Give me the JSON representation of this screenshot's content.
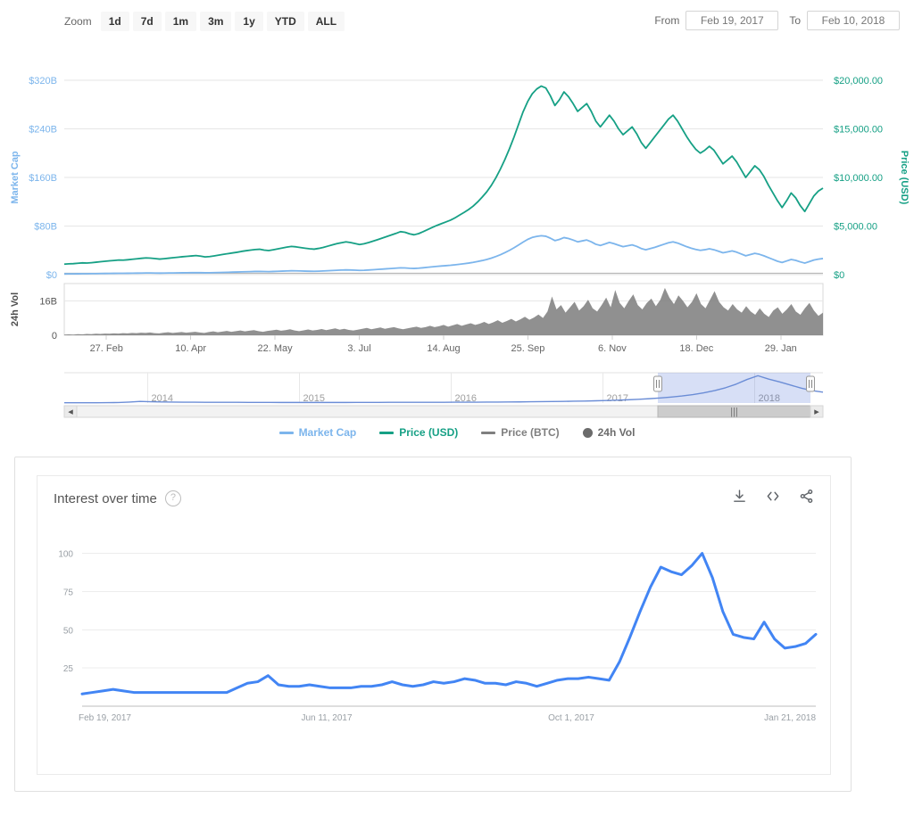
{
  "toolbar": {
    "zoom_label": "Zoom",
    "zoom_buttons": [
      "1d",
      "7d",
      "1m",
      "3m",
      "1y",
      "YTD",
      "ALL"
    ],
    "from_label": "From",
    "from_value": "Feb 19, 2017",
    "to_label": "To",
    "to_value": "Feb 10, 2018"
  },
  "legend": [
    {
      "label": "Market Cap",
      "color": "#7cb5ec",
      "marker": "line"
    },
    {
      "label": "Price (USD)",
      "color": "#16a085",
      "marker": "line"
    },
    {
      "label": "Price (BTC)",
      "color": "#7f7f7f",
      "marker": "line"
    },
    {
      "label": "24h Vol",
      "color": "#6b6b6b",
      "marker": "dot"
    }
  ],
  "navigator": {
    "year_labels": [
      "2014",
      "2015",
      "2016",
      "2017",
      "2018"
    ],
    "selected_from": "2017",
    "selected_to": "2018",
    "handle_left_name": "navigator-handle-left",
    "handle_right_name": "navigator-handle-right",
    "scroll_left_icon": "◂",
    "scroll_right_icon": "▸",
    "grip_icon": "|||"
  },
  "trends_card": {
    "title": "Interest over time",
    "help_icon": "?",
    "actions": [
      {
        "name": "download-icon",
        "title": "download"
      },
      {
        "name": "embed-icon",
        "title": "embed"
      },
      {
        "name": "share-icon",
        "title": "share"
      }
    ]
  },
  "chart_data": [
    {
      "type": "line",
      "title": "",
      "id": "market-cap-price",
      "xlabel": "",
      "x_ticks": [
        "27. Feb",
        "10. Apr",
        "22. May",
        "3. Jul",
        "14. Aug",
        "25. Sep",
        "6. Nov",
        "18. Dec",
        "29. Jan"
      ],
      "left_axis": {
        "label": "Market Cap",
        "color": "#7cb5ec",
        "ticks": [
          "$0",
          "$80B",
          "$160B",
          "$240B",
          "$320B"
        ],
        "ylim": [
          0,
          320
        ]
      },
      "right_axis": {
        "label": "Price (USD)",
        "color": "#16a085",
        "ticks": [
          "$0",
          "$5,000.00",
          "$10,000.00",
          "$15,000.00",
          "$20,000.00"
        ],
        "ylim": [
          0,
          20000
        ]
      },
      "grid": true,
      "legend_position": "bottom",
      "series": [
        {
          "name": "Market Cap",
          "color": "#7cb5ec",
          "values": [
            1.2,
            1.3,
            1.3,
            1.4,
            1.5,
            1.5,
            1.6,
            1.7,
            1.8,
            1.9,
            2.0,
            2.1,
            2.2,
            2.2,
            2.3,
            2.4,
            2.5,
            2.6,
            2.7,
            2.7,
            2.6,
            2.5,
            2.6,
            2.7,
            2.8,
            2.9,
            3.0,
            3.1,
            3.2,
            3.3,
            3.2,
            3.0,
            3.1,
            3.3,
            3.5,
            3.7,
            3.9,
            4.1,
            4.3,
            4.6,
            4.8,
            5.0,
            5.2,
            5.3,
            5.1,
            5.0,
            5.2,
            5.5,
            5.8,
            6.1,
            6.3,
            6.2,
            6.0,
            5.8,
            5.6,
            5.5,
            5.7,
            6.0,
            6.4,
            6.8,
            7.2,
            7.5,
            7.8,
            7.6,
            7.3,
            7.0,
            7.2,
            7.6,
            8.1,
            8.6,
            9.1,
            9.6,
            10.1,
            10.6,
            11.2,
            11.0,
            10.5,
            10.2,
            10.6,
            11.3,
            12.1,
            12.9,
            13.6,
            14.2,
            14.8,
            15.4,
            16.2,
            17.1,
            18.0,
            19.0,
            20.2,
            21.6,
            23.2,
            25.0,
            27.2,
            29.8,
            32.8,
            36.2,
            40.0,
            44.2,
            48.8,
            53.6,
            58.0,
            61.2,
            63.0,
            64.0,
            63.2,
            60.0,
            56.0,
            58.0,
            61.0,
            59.5,
            57.0,
            54.0,
            55.5,
            57.0,
            54.0,
            50.0,
            48.0,
            50.5,
            53.0,
            51.0,
            48.5,
            46.0,
            47.5,
            49.0,
            46.5,
            43.0,
            41.0,
            43.0,
            45.0,
            47.5,
            50.0,
            52.5,
            54.0,
            52.0,
            49.0,
            46.0,
            43.5,
            41.5,
            40.0,
            41.0,
            42.5,
            41.0,
            38.5,
            36.0,
            37.5,
            39.0,
            37.0,
            34.0,
            31.0,
            33.0,
            35.0,
            33.5,
            31.0,
            28.0,
            25.0,
            22.0,
            20.0,
            22.5,
            25.0,
            23.5,
            21.0,
            19.0,
            21.5,
            24.0,
            25.5,
            26.5
          ]
        },
        {
          "name": "Price (USD)",
          "color": "#16a085",
          "values": [
            1080,
            1110,
            1130,
            1170,
            1210,
            1190,
            1230,
            1280,
            1330,
            1380,
            1420,
            1460,
            1500,
            1490,
            1530,
            1580,
            1630,
            1680,
            1720,
            1700,
            1650,
            1600,
            1640,
            1690,
            1740,
            1790,
            1840,
            1880,
            1920,
            1960,
            1900,
            1820,
            1860,
            1930,
            2010,
            2090,
            2160,
            2230,
            2300,
            2390,
            2460,
            2520,
            2580,
            2610,
            2520,
            2480,
            2560,
            2650,
            2740,
            2830,
            2900,
            2860,
            2790,
            2720,
            2660,
            2620,
            2700,
            2800,
            2930,
            3060,
            3190,
            3280,
            3370,
            3300,
            3200,
            3100,
            3180,
            3300,
            3450,
            3600,
            3760,
            3920,
            4080,
            4240,
            4420,
            4360,
            4200,
            4100,
            4220,
            4420,
            4640,
            4860,
            5060,
            5240,
            5420,
            5600,
            5840,
            6120,
            6400,
            6700,
            7050,
            7480,
            7980,
            8520,
            9180,
            9960,
            10860,
            11860,
            12960,
            14160,
            15460,
            16760,
            17800,
            18600,
            19100,
            19400,
            19200,
            18400,
            17400,
            18000,
            18800,
            18300,
            17600,
            16800,
            17200,
            17600,
            16800,
            15800,
            15200,
            15800,
            16400,
            15800,
            15000,
            14400,
            14800,
            15200,
            14500,
            13600,
            13000,
            13600,
            14200,
            14800,
            15400,
            16000,
            16400,
            15800,
            15000,
            14200,
            13500,
            12900,
            12500,
            12800,
            13200,
            12800,
            12100,
            11400,
            11800,
            12200,
            11600,
            10800,
            10000,
            10600,
            11200,
            10800,
            10100,
            9200,
            8400,
            7600,
            6900,
            7600,
            8400,
            7900,
            7100,
            6500,
            7300,
            8100,
            8600,
            8900
          ]
        },
        {
          "name": "Price (BTC)",
          "color": "#7f7f7f",
          "values": [
            1,
            1,
            1,
            1,
            1,
            1,
            1,
            1,
            1,
            1,
            1,
            1,
            1,
            1,
            1,
            1,
            1,
            1,
            1,
            1,
            1,
            1,
            1,
            1,
            1,
            1,
            1,
            1,
            1,
            1,
            1,
            1,
            1,
            1,
            1,
            1,
            1,
            1,
            1,
            1,
            1,
            1,
            1,
            1,
            1,
            1,
            1,
            1,
            1,
            1,
            1,
            1,
            1,
            1,
            1,
            1,
            1,
            1,
            1,
            1,
            1,
            1,
            1,
            1,
            1,
            1,
            1,
            1,
            1,
            1,
            1,
            1,
            1,
            1,
            1,
            1,
            1,
            1,
            1,
            1,
            1,
            1,
            1,
            1,
            1,
            1,
            1,
            1,
            1,
            1,
            1,
            1,
            1,
            1,
            1,
            1,
            1,
            1,
            1,
            1,
            1,
            1,
            1,
            1,
            1,
            1,
            1,
            1,
            1,
            1,
            1,
            1,
            1,
            1,
            1,
            1,
            1,
            1,
            1,
            1,
            1,
            1,
            1,
            1,
            1,
            1,
            1,
            1,
            1,
            1,
            1,
            1,
            1,
            1,
            1,
            1,
            1,
            1,
            1,
            1,
            1,
            1,
            1,
            1,
            1,
            1,
            1,
            1,
            1,
            1,
            1,
            1,
            1,
            1,
            1,
            1,
            1,
            1,
            1,
            1,
            1,
            1,
            1,
            1,
            1,
            1,
            1,
            1,
            1,
            1
          ]
        }
      ]
    },
    {
      "type": "area",
      "id": "volume",
      "title": "",
      "left_axis": {
        "label": "24h Vol",
        "color": "#4d4d4d",
        "ticks": [
          "0",
          "16B"
        ],
        "ylim": [
          0,
          24
        ]
      },
      "grid": true,
      "series": [
        {
          "name": "24h Vol",
          "color": "#7c7c7c",
          "values": [
            0.3,
            0.4,
            0.3,
            0.5,
            0.4,
            0.6,
            0.5,
            0.7,
            0.6,
            0.8,
            0.7,
            0.9,
            0.8,
            1.0,
            0.9,
            1.1,
            1.0,
            1.2,
            1.1,
            1.3,
            1.0,
            0.9,
            1.2,
            1.4,
            1.1,
            1.3,
            1.5,
            1.2,
            1.4,
            1.6,
            1.3,
            1.1,
            1.5,
            1.8,
            1.4,
            1.7,
            2.0,
            1.6,
            1.9,
            2.2,
            1.8,
            2.1,
            2.4,
            1.9,
            1.6,
            2.0,
            2.3,
            2.6,
            2.1,
            2.4,
            2.8,
            2.2,
            1.9,
            2.3,
            2.7,
            2.2,
            2.5,
            2.9,
            2.4,
            2.8,
            3.2,
            2.6,
            3.0,
            2.5,
            2.2,
            2.6,
            3.0,
            3.4,
            2.8,
            3.2,
            3.6,
            3.0,
            3.4,
            3.8,
            3.2,
            2.8,
            3.2,
            3.6,
            4.0,
            3.4,
            3.8,
            4.4,
            3.8,
            4.2,
            4.8,
            4.0,
            4.6,
            5.2,
            4.4,
            5.0,
            5.6,
            4.8,
            5.4,
            6.2,
            5.2,
            6.0,
            7.0,
            5.8,
            6.6,
            7.6,
            6.4,
            7.4,
            8.6,
            7.2,
            8.2,
            9.6,
            8.0,
            11.0,
            18.0,
            12.0,
            14.0,
            10.5,
            13.0,
            15.5,
            11.5,
            13.5,
            16.5,
            12.5,
            11.0,
            14.0,
            17.5,
            13.0,
            21.0,
            15.0,
            12.5,
            16.0,
            19.0,
            14.0,
            12.0,
            15.0,
            17.0,
            13.5,
            16.5,
            22.0,
            17.5,
            14.5,
            18.5,
            16.0,
            13.0,
            15.5,
            19.5,
            14.5,
            12.5,
            16.5,
            20.5,
            15.5,
            13.0,
            11.5,
            14.5,
            12.0,
            10.5,
            13.5,
            11.0,
            9.5,
            12.5,
            10.0,
            8.5,
            11.5,
            13.0,
            10.0,
            12.0,
            14.5,
            11.0,
            9.5,
            12.5,
            15.0,
            11.5,
            9.0,
            10.5
          ]
        }
      ]
    },
    {
      "type": "line",
      "id": "navigator",
      "title": "",
      "x_ticks": [
        "2014",
        "2015",
        "2016",
        "2017",
        "2018"
      ],
      "series": [
        {
          "name": "Market Cap",
          "color": "#6b8dd6",
          "values": [
            0.4,
            0.4,
            0.5,
            0.5,
            0.6,
            0.8,
            1.6,
            2.6,
            2.0,
            1.7,
            1.5,
            1.4,
            1.3,
            1.2,
            1.2,
            1.1,
            1.1,
            1.0,
            1.0,
            1.0,
            0.9,
            0.9,
            0.9,
            0.9,
            0.9,
            0.9,
            0.9,
            1.0,
            1.0,
            1.0,
            1.1,
            1.1,
            1.1,
            1.2,
            1.2,
            1.2,
            1.3,
            1.3,
            1.4,
            1.5,
            1.6,
            1.7,
            1.8,
            2.0,
            2.2,
            2.4,
            2.6,
            2.9,
            3.2,
            3.6,
            4.0,
            4.6,
            5.2,
            6.0,
            7.0,
            8.2,
            9.6,
            11.4,
            13.6,
            16.4,
            20.0,
            24.6,
            30.5,
            38.0,
            44.0,
            38.5,
            34.0,
            29.0,
            24.0,
            20.0,
            17.5
          ]
        }
      ]
    },
    {
      "type": "line",
      "id": "interest-over-time",
      "title": "Interest over time",
      "xlabel": "",
      "ylabel": "",
      "ylim": [
        0,
        105
      ],
      "y_ticks": [
        25,
        50,
        75,
        100
      ],
      "x_ticks": [
        "Feb 19, 2017",
        "Jun 11, 2017",
        "Oct 1, 2017",
        "Jan 21, 2018"
      ],
      "grid": true,
      "color": "#4285f4",
      "values": [
        8,
        9,
        10,
        11,
        10,
        9,
        9,
        9,
        9,
        9,
        9,
        9,
        9,
        9,
        9,
        12,
        15,
        16,
        20,
        14,
        13,
        13,
        14,
        13,
        12,
        12,
        12,
        13,
        13,
        14,
        16,
        14,
        13,
        14,
        16,
        15,
        16,
        18,
        17,
        15,
        15,
        14,
        16,
        15,
        13,
        15,
        17,
        18,
        18,
        19,
        18,
        17,
        29,
        45,
        62,
        78,
        91,
        88,
        86,
        92,
        100,
        84,
        62,
        47,
        45,
        44,
        55,
        44,
        38,
        39,
        41,
        47
      ]
    }
  ]
}
